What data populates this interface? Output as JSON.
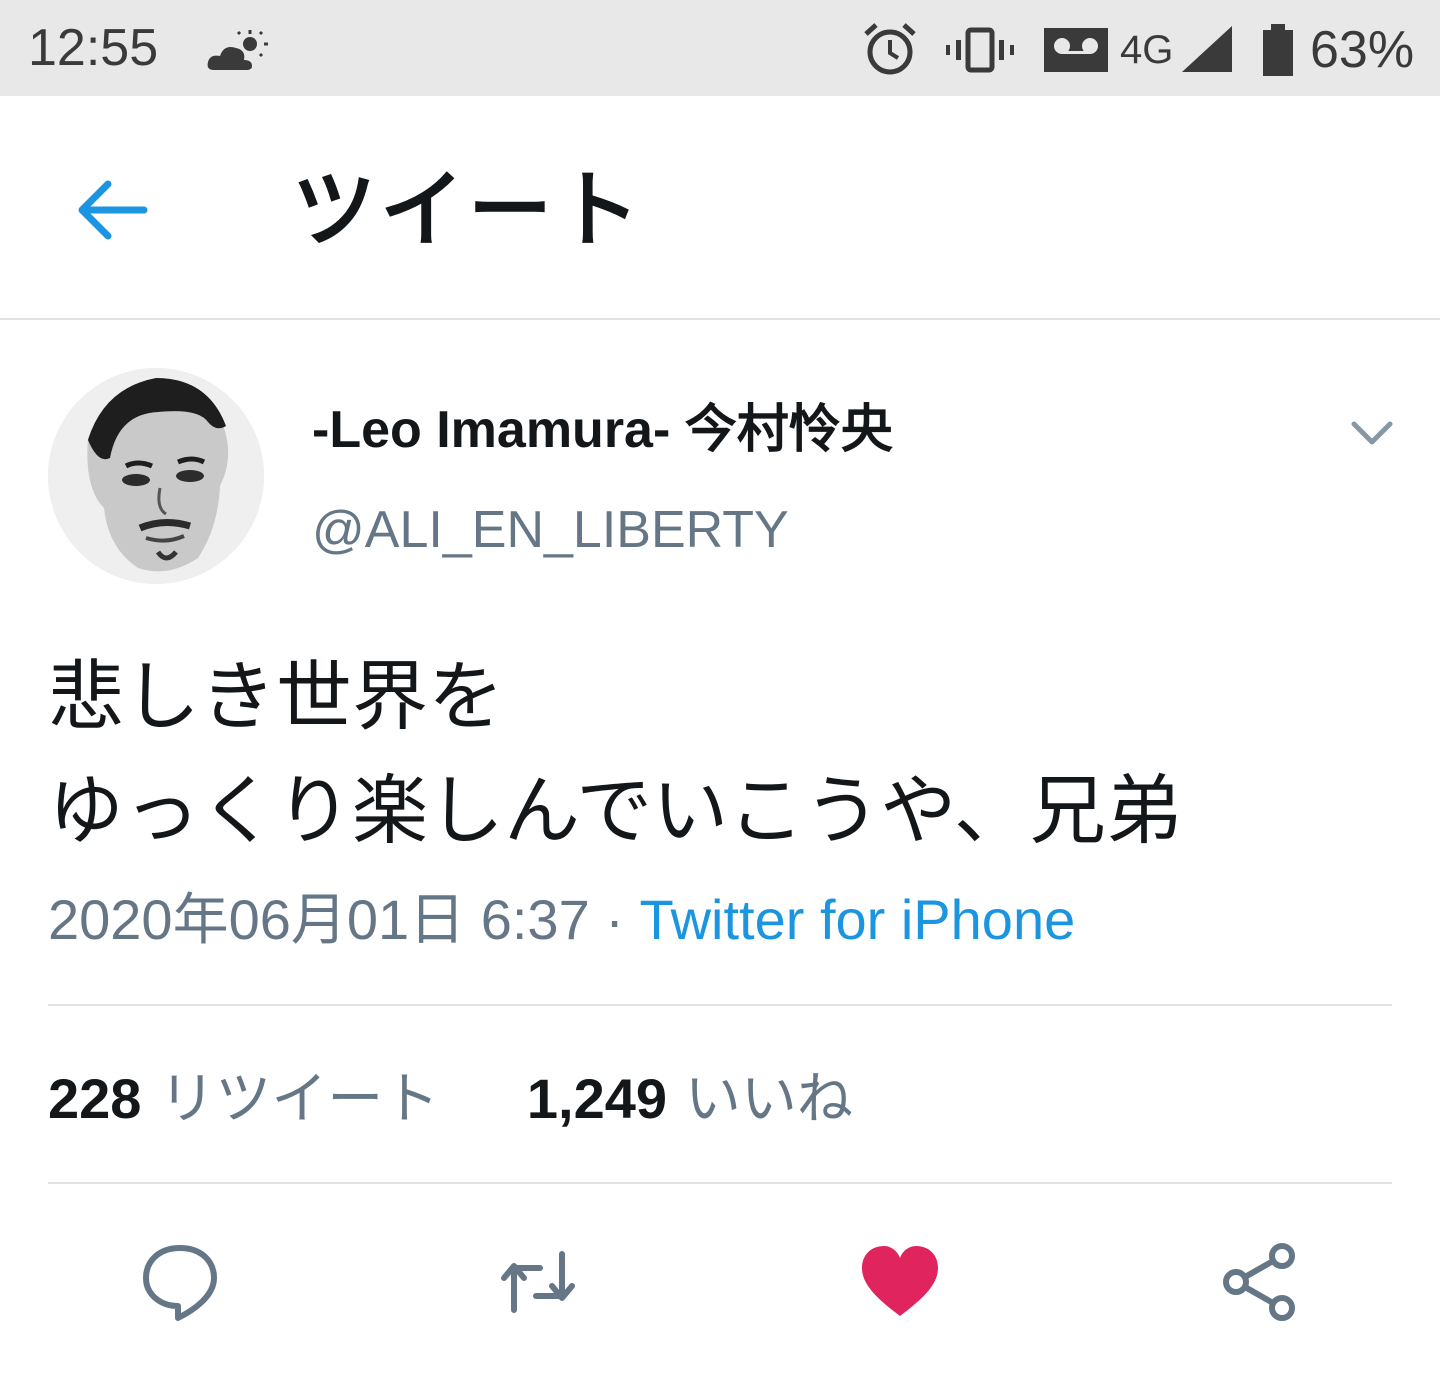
{
  "status_bar": {
    "time": "12:55",
    "network": "4G",
    "battery": "63%"
  },
  "header": {
    "title": "ツイート"
  },
  "tweet": {
    "author_name": "-Leo Imamura- 今村怜央",
    "author_handle": "@ALI_EN_LIBERTY",
    "text_lines": [
      "悲しき世界を",
      "ゆっくり楽しんでいこうや、兄弟"
    ],
    "date": "2020年06月01日 6:37",
    "separator": " · ",
    "source": "Twitter for iPhone"
  },
  "stats": {
    "retweets_count": "228",
    "retweets_label": "リツイート",
    "likes_count": "1,249",
    "likes_label": "いいね"
  },
  "colors": {
    "accent": "#1b95e0",
    "secondary_text": "#657786",
    "like": "#e0245e",
    "status_bar_bg": "#e8e8e8"
  },
  "icons": {
    "back": "arrow-left-icon",
    "more": "chevron-down-icon",
    "reply": "reply-icon",
    "retweet": "retweet-icon",
    "like": "heart-icon",
    "share": "share-icon"
  }
}
